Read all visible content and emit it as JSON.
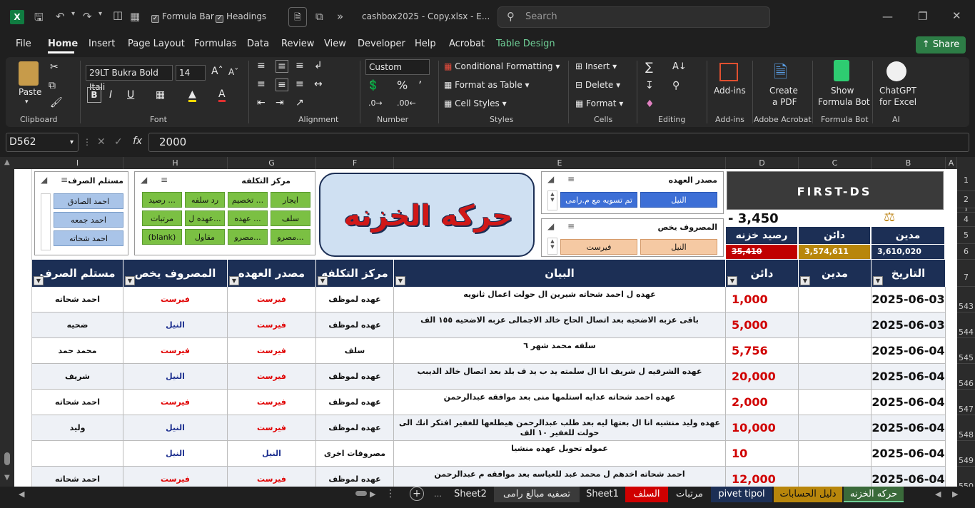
{
  "titlebar": {
    "autosave_label": "Formula Bar",
    "headings_label": "Headings",
    "filename": "cashbox2025 - Copy.xlsx  -  E...",
    "search_placeholder": "Search"
  },
  "menu": {
    "items": [
      "File",
      "Home",
      "Insert",
      "Page Layout",
      "Formulas",
      "Data",
      "Review",
      "View",
      "Developer",
      "Help",
      "Acrobat",
      "Table Design"
    ],
    "share": "Share"
  },
  "ribbon": {
    "paste": "Paste",
    "font_name": "29LT Bukra Bold Itali",
    "font_size": "14",
    "number_format": "Custom",
    "conditional_formatting": "Conditional Formatting",
    "format_as_table": "Format as Table",
    "cell_styles": "Cell Styles",
    "insert": "Insert",
    "delete": "Delete",
    "format": "Format",
    "addins": "Add-ins",
    "create_pdf_1": "Create",
    "create_pdf_2": "a PDF",
    "show_bot_1": "Show",
    "show_bot_2": "Formula Bot",
    "chatgpt_1": "ChatGPT",
    "chatgpt_2": "for Excel",
    "groups": [
      "Clipboard",
      "Font",
      "Alignment",
      "Number",
      "Styles",
      "Cells",
      "Editing",
      "Add-ins",
      "Adobe Acrobat",
      "Formula Bot",
      "AI"
    ]
  },
  "formula_bar": {
    "name_box": "D562",
    "formula": "2000"
  },
  "columns": [
    "I",
    "H",
    "G",
    "F",
    "E",
    "D",
    "C",
    "B",
    "A"
  ],
  "rows_top": [
    "1",
    "2",
    "3",
    "4",
    "5",
    "6",
    "7"
  ],
  "slicers": {
    "recipient": {
      "title": "مستلم الصرف",
      "items": [
        "احمد الصادق",
        "احمد جمعه",
        "احمد شحاته"
      ]
    },
    "cost_center": {
      "title": "مركز التكلفه",
      "items": [
        "ايجار",
        "تخصيم ...",
        "رد سلفه",
        "رصيد ...",
        "سلف",
        "عهده ل...",
        "مرتبات",
        "مصرو...",
        "مقاول",
        "(blank)",
        "عهده ..."
      ]
    },
    "custody_source": {
      "title": "مصدر العهده",
      "items": [
        "النيل",
        "تم تسويه مع م.رامى"
      ]
    },
    "expense_for": {
      "title": "المصروف  يخص",
      "items": [
        "النيل",
        "فيرست"
      ]
    }
  },
  "banner": {
    "title": "حركه الخزنه",
    "logo_text": "FIRST-DS"
  },
  "summary": {
    "balance_value": "- 3,450",
    "labels": [
      "رصيد خزنه",
      "دائن",
      "مدين"
    ],
    "values": [
      "35,410",
      "3,574,611",
      "3,610,020"
    ]
  },
  "table": {
    "headers": [
      "مستلم الصرف",
      "المصروف  يخص",
      "مصدر العهده",
      "مركز التكلفه",
      "البيان",
      "دائن",
      "مدين",
      "التاريخ"
    ],
    "rows": [
      {
        "row": "543",
        "recipient": "احمد شحاته",
        "for": "فيرست",
        "source": "فيرست",
        "center": "عهده لموظف",
        "desc": "عهده ل احمد شحاته شيرين ال حولت اعمال ثانويه",
        "credit": "1,000",
        "debit": "",
        "date": "2025-06-03"
      },
      {
        "row": "544",
        "recipient": "ضحيه",
        "for": "النيل",
        "source": "فيرست",
        "center": "عهده لموظف",
        "desc": "باقى عزبه الاضحيه بعد اتصال الحاج خالد الاجمالى عزبه الاضحيه ١٥٥ الف",
        "credit": "5,000",
        "debit": "",
        "date": "2025-06-03"
      },
      {
        "row": "545",
        "recipient": "محمد حمد",
        "for": "فيرست",
        "source": "فيرست",
        "center": "سلف",
        "desc": "سلفه محمد شهر ٦",
        "credit": "5,756",
        "debit": "",
        "date": "2025-06-04"
      },
      {
        "row": "546",
        "recipient": "شريف",
        "for": "النيل",
        "source": "فيرست",
        "center": "عهده لموظف",
        "desc": "عهده الشرقيه ل شريف انا ال سلمته يد ب يد ف بلد بعد اتصال خالد الديبب",
        "credit": "20,000",
        "debit": "",
        "date": "2025-06-04"
      },
      {
        "row": "547",
        "recipient": "احمد شحاته",
        "for": "فيرست",
        "source": "فيرست",
        "center": "عهده لموظف",
        "desc": "عهده احمد شحاته عدايه استلمها منى بعد موافقه عبدالرحمن",
        "credit": "2,000",
        "debit": "",
        "date": "2025-06-04"
      },
      {
        "row": "548",
        "recipient": "وليد",
        "for": "النيل",
        "source": "فيرست",
        "center": "عهده لموظف",
        "desc": "عهده وليد منشيه انا ال بعتها ليه بعد طلب عبدالرحمن هيطلعها للغفير افتكر انك الى حولت للغفير ١٠ الف",
        "credit": "10,000",
        "debit": "",
        "date": "2025-06-04"
      },
      {
        "row": "549",
        "recipient": "",
        "for": "النيل",
        "source": "النيل",
        "center": "مصروفات اخرى",
        "desc": "عموله تحويل عهده منشيا",
        "credit": "10",
        "debit": "",
        "date": "2025-06-04"
      },
      {
        "row": "550",
        "recipient": "احمد شحاته",
        "for": "فيرست",
        "source": "فيرست",
        "center": "عهده لموظف",
        "desc": "احمد شحاته اخدهم ل محمد عبد للعياسه بعد موافقه م عبدالرحمن",
        "credit": "12,000",
        "debit": "",
        "date": "2025-06-04"
      }
    ]
  },
  "tabs": [
    "Sheet2",
    "تصفيه مبالغ رامى",
    "Sheet1",
    "السلف",
    "مرتبات",
    "pivet tipol",
    "دليل الحسابات",
    "حركه الخزنه"
  ],
  "colors": {
    "header_navy": "#1c2f55",
    "accent_green": "#107c41",
    "slicer_green": "#7bc043",
    "tab_active": "#3a6a3a"
  }
}
